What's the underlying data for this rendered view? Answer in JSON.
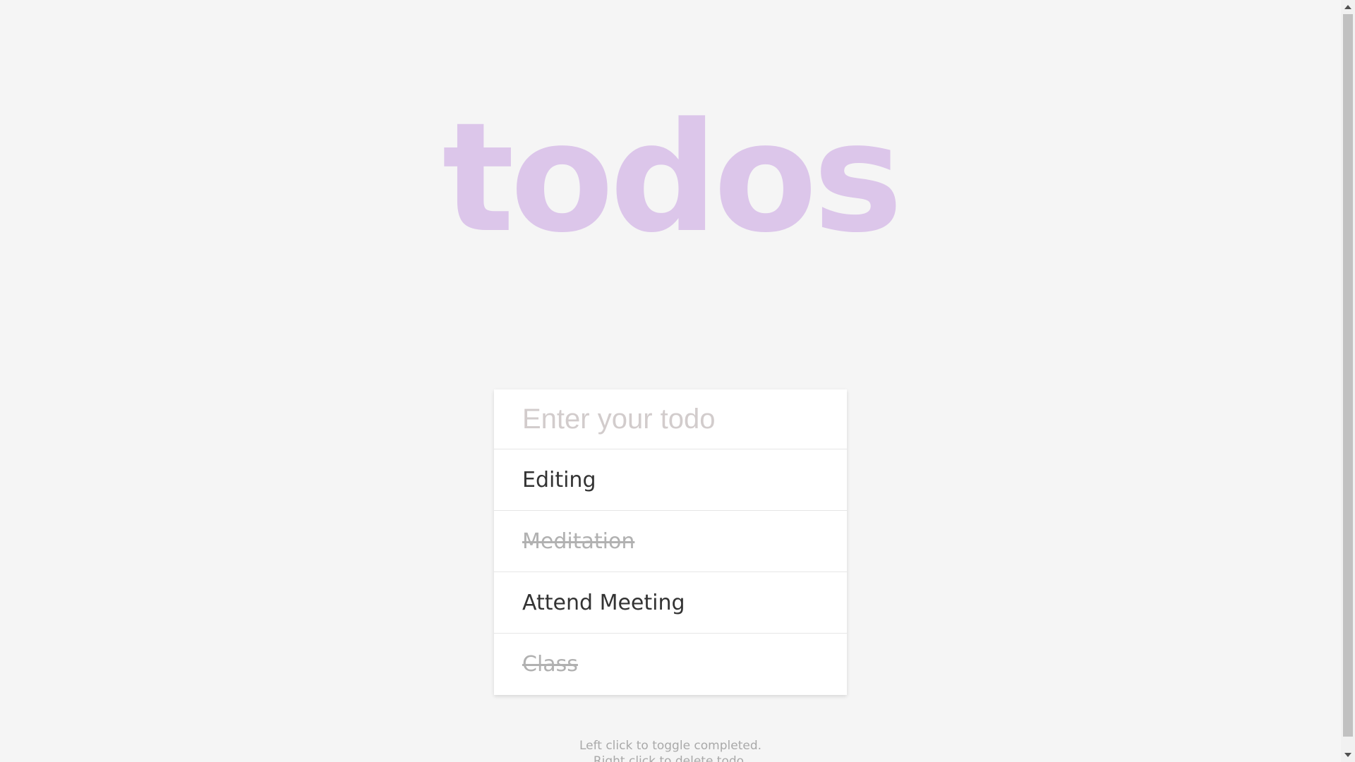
{
  "app": {
    "title": "todos"
  },
  "input": {
    "placeholder": "Enter your todo",
    "value": ""
  },
  "todos": [
    {
      "label": "Editing",
      "completed": false
    },
    {
      "label": "Meditation",
      "completed": true
    },
    {
      "label": "Attend Meeting",
      "completed": false
    },
    {
      "label": "Class",
      "completed": true
    }
  ],
  "hints": {
    "toggle": "Left click to toggle completed.",
    "delete": "Right click to delete todo."
  },
  "colors": {
    "title": "#dcc6ea",
    "background": "#f5f5f5",
    "completed_text": "#b1b1b1",
    "active_text": "#333333"
  },
  "scrollbar": {
    "up_icon": "triangle-up-icon",
    "down_icon": "triangle-down-icon"
  }
}
